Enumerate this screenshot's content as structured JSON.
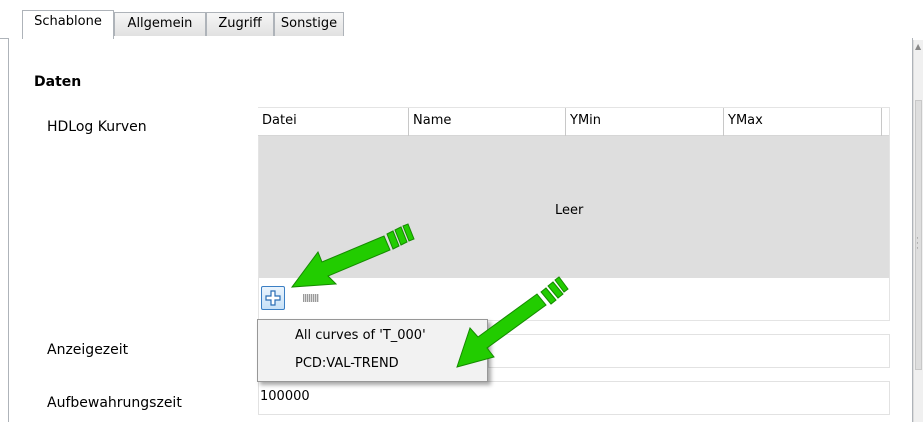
{
  "tabs": [
    {
      "label": "Schablone",
      "active": true
    },
    {
      "label": "Allgemein",
      "active": false
    },
    {
      "label": "Zugriff",
      "active": false
    },
    {
      "label": "Sonstige",
      "active": false
    }
  ],
  "section_title": "Daten",
  "hdlog": {
    "label": "HDLog Kurven",
    "columns": [
      "Datei",
      "Name",
      "YMin",
      "YMax"
    ],
    "empty_text": "Leer",
    "add_icon": "plus-icon",
    "remove_icon": "minus-icon"
  },
  "menu": {
    "items": [
      "All curves of 'T_000'",
      "PCD:VAL-TREND"
    ]
  },
  "anzeigezeit": {
    "label": "Anzeigezeit",
    "value": ""
  },
  "aufbewahrungszeit": {
    "label": "Aufbewahrungszeit",
    "value": "100000"
  },
  "colors": {
    "annotation_arrow": "#22cc00",
    "add_button": "#3b7fc4",
    "table_empty_bg": "#dedede"
  }
}
